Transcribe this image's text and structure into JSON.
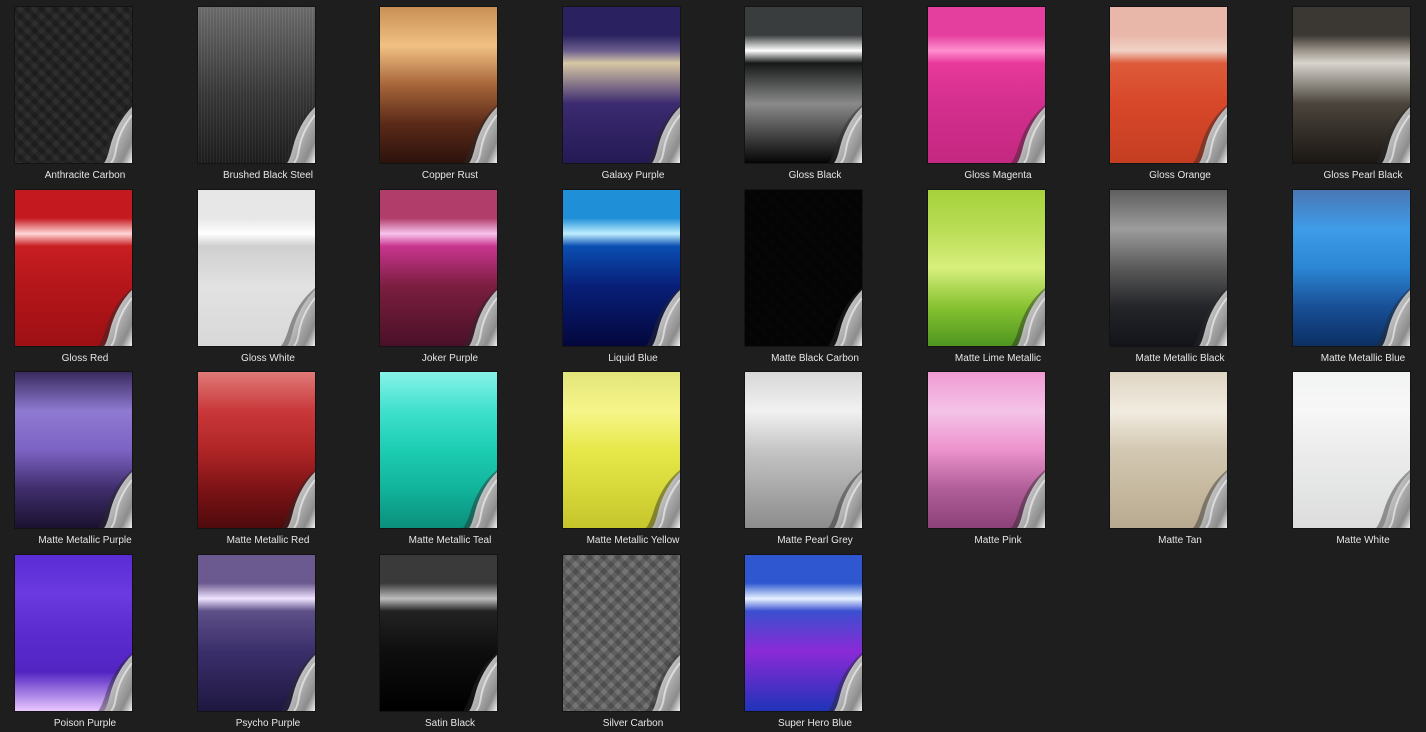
{
  "swatches": [
    {
      "label": "Anthracite Carbon",
      "pattern": "carbon",
      "colors": [
        "#8a8a8a",
        "#6a6a6a",
        "#555555"
      ]
    },
    {
      "label": "Brushed Black Steel",
      "pattern": "brushed",
      "colors": [
        "#6f6f6f",
        "#3a3a3a",
        "#1e1e1e"
      ]
    },
    {
      "label": "Copper Rust",
      "pattern": "gradient",
      "colors": [
        "#c98f55",
        "#f1c183",
        "#a7653a",
        "#5a2a18",
        "#2c120c"
      ]
    },
    {
      "label": "Galaxy Purple",
      "pattern": "gloss",
      "colors": [
        "#2a2260",
        "#6b5e8f",
        "#d6c7a4",
        "#3b2a70",
        "#241a55"
      ]
    },
    {
      "label": "Gloss Black",
      "pattern": "gloss",
      "colors": [
        "#3a3d3d",
        "#ffffff",
        "#161818",
        "#8a8a8a",
        "#050505"
      ]
    },
    {
      "label": "Gloss Magenta",
      "pattern": "gloss",
      "colors": [
        "#e43e9e",
        "#ff8fcf",
        "#e8399a",
        "#d42f8f",
        "#c4287f"
      ]
    },
    {
      "label": "Gloss Orange",
      "pattern": "gloss",
      "colors": [
        "#e9b7aa",
        "#f0d2c6",
        "#dd5b3a",
        "#d8472a",
        "#c43e22"
      ]
    },
    {
      "label": "Gloss Pearl Black",
      "pattern": "gloss",
      "colors": [
        "#3b3733",
        "#9b948b",
        "#d8d4cd",
        "#4a443c",
        "#1b1713"
      ]
    },
    {
      "label": "Gloss Red",
      "pattern": "gloss",
      "colors": [
        "#c41a1f",
        "#ffd6d6",
        "#c81e22",
        "#b4161a",
        "#9d1014"
      ]
    },
    {
      "label": "Gloss White",
      "pattern": "gloss",
      "colors": [
        "#e7e7e7",
        "#ffffff",
        "#cfcfcf",
        "#e2e2e2",
        "#d8d8d8"
      ]
    },
    {
      "label": "Joker Purple",
      "pattern": "gloss",
      "colors": [
        "#b03d6a",
        "#f7c3ec",
        "#c9358f",
        "#7a1e3f",
        "#4a1027"
      ]
    },
    {
      "label": "Liquid Blue",
      "pattern": "gloss",
      "colors": [
        "#1f8fd8",
        "#bfefff",
        "#0a4eb2",
        "#081f78",
        "#04073d"
      ]
    },
    {
      "label": "Matte Black Carbon",
      "pattern": "carbon",
      "colors": [
        "#3a3a3a",
        "#2a2a2a",
        "#1b1b1b"
      ]
    },
    {
      "label": "Matte Lime Metallic",
      "pattern": "gradient",
      "colors": [
        "#a6d23c",
        "#b9dd55",
        "#d7ef7c",
        "#86c231",
        "#4f9620"
      ]
    },
    {
      "label": "Matte Metallic Black",
      "pattern": "gradient",
      "colors": [
        "#5e5e5e",
        "#9c9c9c",
        "#5a5a5a",
        "#242529",
        "#12141a"
      ]
    },
    {
      "label": "Matte Metallic Blue",
      "pattern": "gradient",
      "colors": [
        "#4a77b6",
        "#3e9ce8",
        "#2b86d3",
        "#184f96",
        "#0c2f63"
      ]
    },
    {
      "label": "Matte Metallic Purple",
      "pattern": "gradient",
      "colors": [
        "#3a2b5e",
        "#8f7ad2",
        "#7c63c4",
        "#3f2d6b",
        "#1a1230"
      ]
    },
    {
      "label": "Matte Metallic Red",
      "pattern": "gradient",
      "colors": [
        "#e07a78",
        "#c9383a",
        "#b02526",
        "#7d1316",
        "#4e0a0c"
      ]
    },
    {
      "label": "Matte Metallic Teal",
      "pattern": "gradient",
      "colors": [
        "#87f3e8",
        "#3fe0cd",
        "#1ccdb2",
        "#12b39b",
        "#0b8f7c"
      ]
    },
    {
      "label": "Matte Metallic Yellow",
      "pattern": "gradient",
      "colors": [
        "#e2e57a",
        "#f6f58a",
        "#e7e84a",
        "#d6d939",
        "#c5c52c"
      ]
    },
    {
      "label": "Matte Pearl Grey",
      "pattern": "gradient",
      "colors": [
        "#d7d7d7",
        "#f1f1f1",
        "#c5c5c5",
        "#a8a8a8",
        "#8c8c8c"
      ]
    },
    {
      "label": "Matte Pink",
      "pattern": "gradient",
      "colors": [
        "#ef9ad2",
        "#f4c3e8",
        "#ec92cc",
        "#b05e98",
        "#8c4178"
      ]
    },
    {
      "label": "Matte Tan",
      "pattern": "gradient",
      "colors": [
        "#ded4c2",
        "#f1ece0",
        "#d3c8b2",
        "#c6b9a0",
        "#b7aa90"
      ]
    },
    {
      "label": "Matte White",
      "pattern": "gradient",
      "colors": [
        "#f2f3f3",
        "#f7f7f7",
        "#ececec",
        "#e4e5e5",
        "#dcdcdc"
      ]
    },
    {
      "label": "Poison Purple",
      "pattern": "gradient",
      "colors": [
        "#5a2cd4",
        "#6b3ae0",
        "#5b2bcf",
        "#5225c2",
        "#e9c7ff"
      ]
    },
    {
      "label": "Psycho Purple",
      "pattern": "gloss",
      "colors": [
        "#6b5a8f",
        "#efe3ff",
        "#5d4f87",
        "#3b2f6b",
        "#1e1740"
      ]
    },
    {
      "label": "Satin Black",
      "pattern": "gloss",
      "colors": [
        "#3a3a3a",
        "#bdbdbd",
        "#222222",
        "#0e0e0e",
        "#000000"
      ]
    },
    {
      "label": "Silver Carbon",
      "pattern": "carbon",
      "colors": [
        "#cfcfcf",
        "#a9a9a9",
        "#8f8f8f"
      ]
    },
    {
      "label": "Super Hero Blue",
      "pattern": "gloss",
      "colors": [
        "#2f58d0",
        "#e6f2ff",
        "#3b4fd0",
        "#8a2ad6",
        "#1f33b8"
      ]
    }
  ]
}
